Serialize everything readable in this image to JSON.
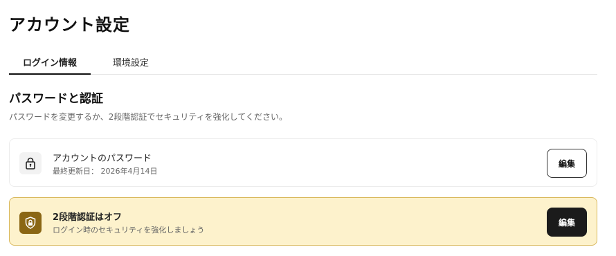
{
  "page": {
    "title": "アカウント設定"
  },
  "tabs": [
    {
      "label": "ログイン情報",
      "active": true
    },
    {
      "label": "環境設定",
      "active": false
    }
  ],
  "section": {
    "title": "パスワードと認証",
    "description": "パスワードを変更するか、2段階認証でセキュリティを強化してください。"
  },
  "password_card": {
    "icon": "lock-icon",
    "title": "アカウントのパスワード",
    "subtitle": "最終更新日： 2026年4月14日",
    "button": "編集"
  },
  "twofa_card": {
    "icon": "shield-lock-icon",
    "title": "2段階認証はオフ",
    "subtitle": "ログイン時のセキュリティを強化しましょう",
    "button": "編集",
    "accent_color": "#8a6614",
    "background_color": "#fdf2cc"
  }
}
